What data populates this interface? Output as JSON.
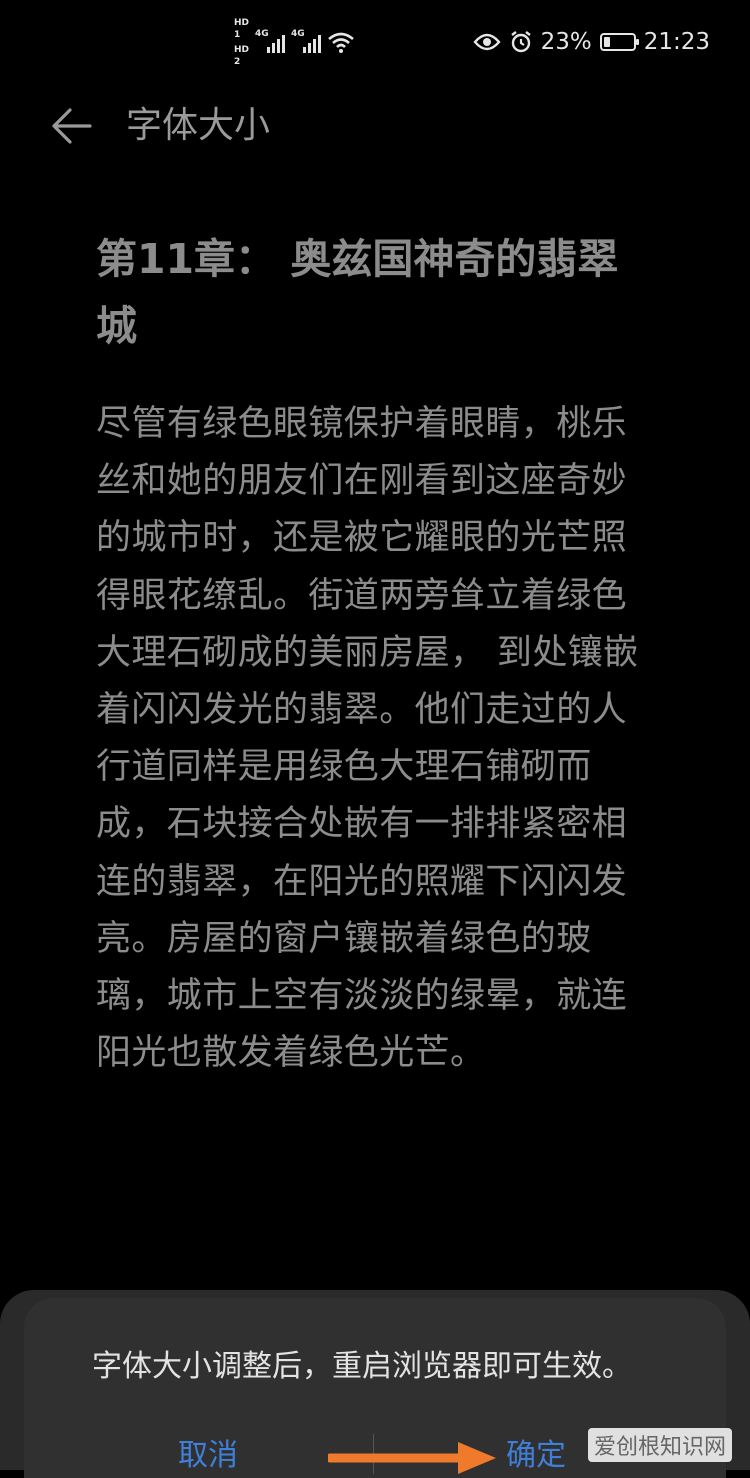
{
  "status_bar": {
    "hd_top": "HD",
    "sim1": "1",
    "hd_bottom": "HD",
    "sim2": "2",
    "net1": "4G",
    "net2": "4G",
    "battery_percent": "23%",
    "battery_level": 0.23,
    "time": "21:23",
    "icons": [
      "eye-comfort-icon",
      "alarm-icon",
      "wifi-icon",
      "signal-icon",
      "battery-icon"
    ]
  },
  "header": {
    "title": "字体大小",
    "back_icon": "back-arrow-icon"
  },
  "preview": {
    "chapter_title": "第11章： 奥兹国神奇的翡翠城",
    "body": "尽管有绿色眼镜保护着眼睛，桃乐丝和她的朋友们在刚看到这座奇妙的城市时，还是被它耀眼的光芒照得眼花缭乱。街道两旁耸立着绿色大理石砌成的美丽房屋， 到处镶嵌着闪闪发光的翡翠。他们走过的人行道同样是用绿色大理石铺砌而成，石块接合处嵌有一排排紧密相连的翡翠，在阳光的照耀下闪闪发亮。房屋的窗户镶嵌着绿色的玻璃，城市上空有淡淡的绿晕，就连阳光也散发着绿色光芒。"
  },
  "dialog": {
    "message": "字体大小调整后，重启浏览器即可生效。",
    "cancel_label": "取消",
    "confirm_label": "确定"
  },
  "watermark": "爱创根知识网",
  "colors": {
    "background": "#000000",
    "text": "#8c8c8c",
    "dialog": "#303030",
    "accent": "#3f7fd8",
    "annotation_arrow": "#f07a2c"
  }
}
